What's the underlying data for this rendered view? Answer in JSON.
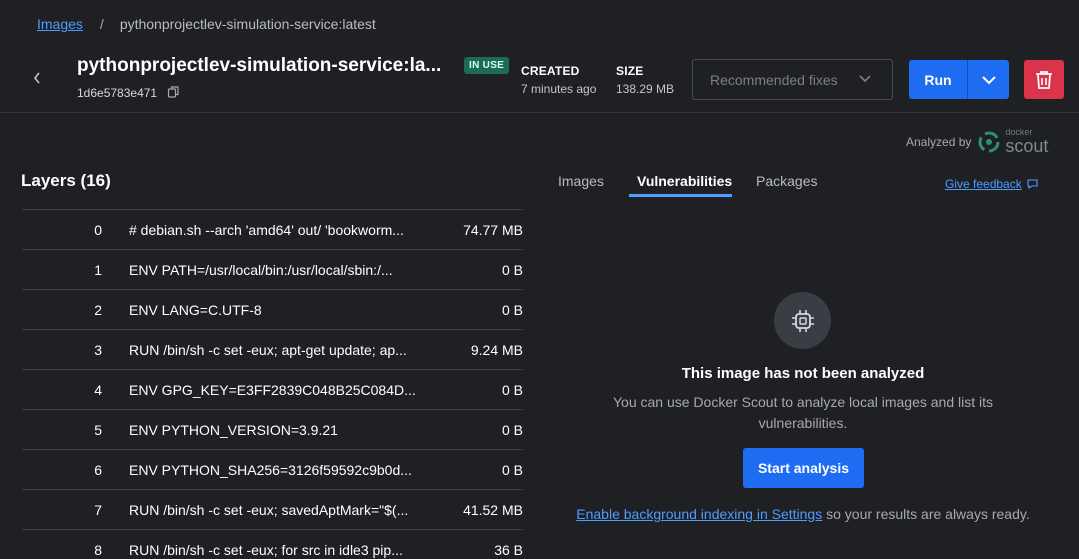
{
  "breadcrumb": {
    "root": "Images",
    "separator": "/",
    "current": "pythonprojectlev-simulation-service:latest"
  },
  "header": {
    "title": "pythonprojectlev-simulation-service:la...",
    "badge": "IN USE",
    "image_id": "1d6e5783e471",
    "created_label": "CREATED",
    "created_value": "7 minutes ago",
    "size_label": "SIZE",
    "size_value": "138.29 MB",
    "recommended_fixes": "Recommended fixes",
    "run_label": "Run"
  },
  "analyzed": {
    "label": "Analyzed by",
    "brand_small": "docker",
    "brand_big": "scout"
  },
  "layers": {
    "title": "Layers (16)",
    "rows": [
      {
        "index": "0",
        "command": "# debian.sh --arch 'amd64' out/ 'bookworm...",
        "size": "74.77 MB"
      },
      {
        "index": "1",
        "command": "ENV PATH=/usr/local/bin:/usr/local/sbin:/...",
        "size": "0 B"
      },
      {
        "index": "2",
        "command": "ENV LANG=C.UTF-8",
        "size": "0 B"
      },
      {
        "index": "3",
        "command": "RUN /bin/sh -c set -eux; apt-get update; ap...",
        "size": "9.24 MB"
      },
      {
        "index": "4",
        "command": "ENV GPG_KEY=E3FF2839C048B25C084D...",
        "size": "0 B"
      },
      {
        "index": "5",
        "command": "ENV PYTHON_VERSION=3.9.21",
        "size": "0 B"
      },
      {
        "index": "6",
        "command": "ENV PYTHON_SHA256=3126f59592c9b0d...",
        "size": "0 B"
      },
      {
        "index": "7",
        "command": "RUN /bin/sh -c set -eux; savedAptMark=\"$(...",
        "size": "41.52 MB"
      },
      {
        "index": "8",
        "command": "RUN /bin/sh -c set -eux; for src in idle3 pip...",
        "size": "36 B"
      }
    ]
  },
  "tabs": {
    "images": "Images",
    "vulnerabilities": "Vulnerabilities",
    "packages": "Packages"
  },
  "feedback": "Give feedback",
  "empty_state": {
    "title": "This image has not been analyzed",
    "description": "You can use Docker Scout to analyze local images and list its vulnerabilities.",
    "button": "Start analysis",
    "link": "Enable background indexing in Settings",
    "link_suffix": " so your results are always ready."
  },
  "colors": {
    "accent": "#1d6cf2",
    "danger": "#d9344a",
    "badge": "#1b6b55",
    "link": "#4d9dff",
    "background": "#1f2024"
  },
  "icons": [
    "chevron-left-icon",
    "copy-icon",
    "chevron-down-icon",
    "trash-icon",
    "docker-scout-logo",
    "chat-icon",
    "chip-icon"
  ]
}
